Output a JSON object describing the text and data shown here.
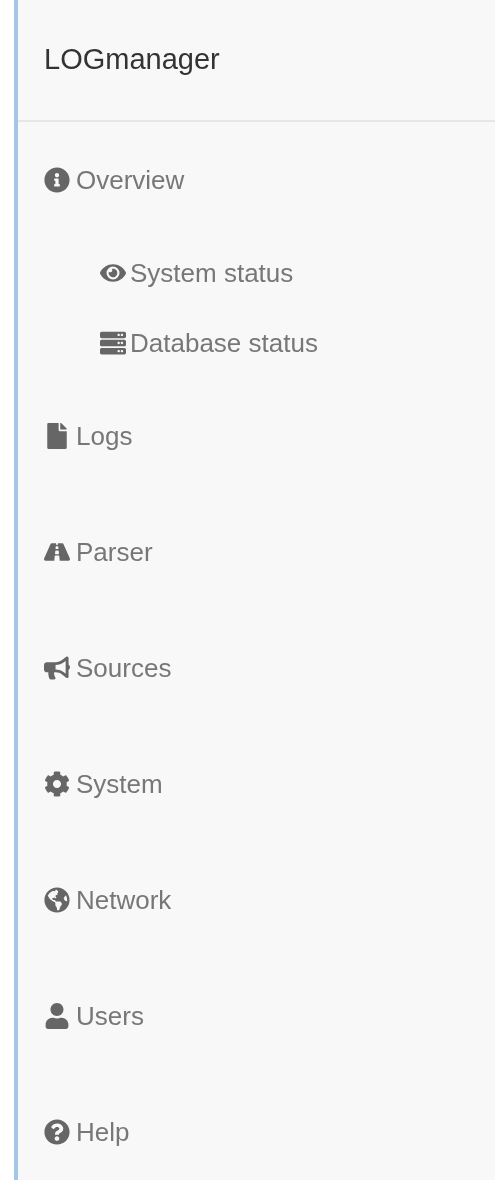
{
  "brand": "LOGmanager",
  "menu": [
    {
      "label": "Overview",
      "children": [
        {
          "label": "System status"
        },
        {
          "label": "Database status"
        }
      ]
    },
    {
      "label": "Logs"
    },
    {
      "label": "Parser"
    },
    {
      "label": "Sources"
    },
    {
      "label": "System"
    },
    {
      "label": "Network"
    },
    {
      "label": "Users"
    },
    {
      "label": "Help"
    }
  ]
}
